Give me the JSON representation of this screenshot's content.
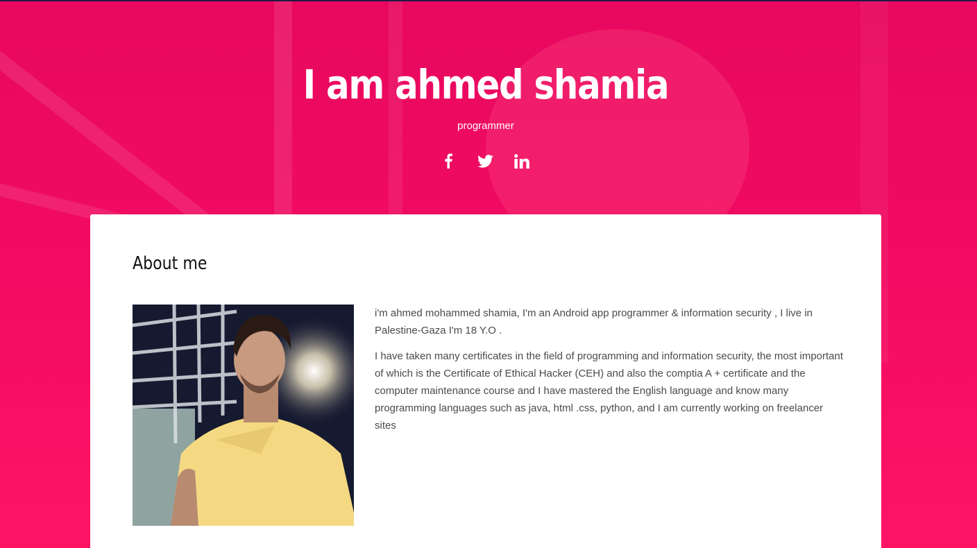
{
  "hero": {
    "title": "I am ahmed shamia",
    "subtitle": "programmer",
    "background_color": "#f20b62"
  },
  "social": [
    {
      "name": "facebook",
      "icon": "facebook-icon"
    },
    {
      "name": "twitter",
      "icon": "twitter-icon"
    },
    {
      "name": "linkedin",
      "icon": "linkedin-icon"
    }
  ],
  "about": {
    "heading": "About me",
    "paragraphs": [
      "i'm ahmed mohammed shamia, I'm an Android app programmer & information security , I live in Palestine-Gaza I'm 18 Y.O .",
      "I have taken many certificates in the field of programming and information security, the most important of which is the Certificate of Ethical Hacker (CEH) and also the comptia A + certificate and the computer maintenance course and I have mastered the English language and know many programming languages such as java, html .css, python, and I am currently working on freelancer sites"
    ]
  }
}
